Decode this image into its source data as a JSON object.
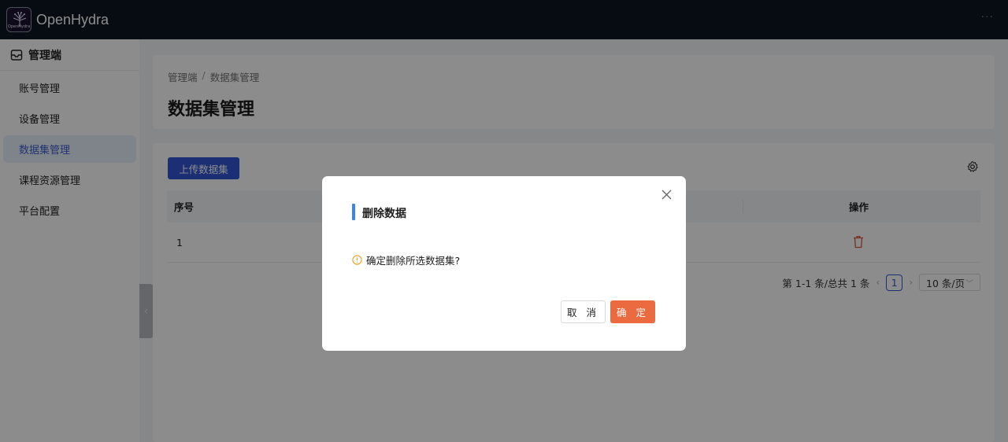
{
  "topbar": {
    "app_name": "OpenHydra",
    "logo_text": "OpenHydra",
    "more_icon": "ellipsis-icon"
  },
  "sidebar": {
    "header_title": "管理端",
    "header_icon": "admin-box-icon",
    "items": [
      {
        "label": "账号管理",
        "active": false
      },
      {
        "label": "设备管理",
        "active": false
      },
      {
        "label": "数据集管理",
        "active": true
      },
      {
        "label": "课程资源管理",
        "active": false
      },
      {
        "label": "平台配置",
        "active": false
      }
    ],
    "collapse_icon": "chevron-left-icon"
  },
  "header": {
    "breadcrumb": [
      "管理端",
      "数据集管理"
    ],
    "breadcrumb_sep": "/",
    "title": "数据集管理"
  },
  "toolbar": {
    "upload_label": "上传数据集",
    "settings_icon": "gear-icon"
  },
  "table": {
    "columns": {
      "index": "序号",
      "actions": "操作"
    },
    "rows": [
      {
        "index": "1",
        "action_icon": "trash-icon"
      }
    ]
  },
  "pagination": {
    "summary": "第 1-1 条/总共 1 条",
    "prev": "‹",
    "current_page": "1",
    "next": "›",
    "page_size": "10 条/页"
  },
  "modal": {
    "title": "删除数据",
    "message": "确定删除所选数据集?",
    "cancel_label": "取 消",
    "ok_label": "确 定",
    "close_icon": "close-icon",
    "warn_icon": "exclamation-circle-icon"
  },
  "colors": {
    "topbar_bg": "#0d1624",
    "primary": "#3457d5",
    "danger": "#ec6a3f",
    "modal_accent": "#3b82f6"
  }
}
